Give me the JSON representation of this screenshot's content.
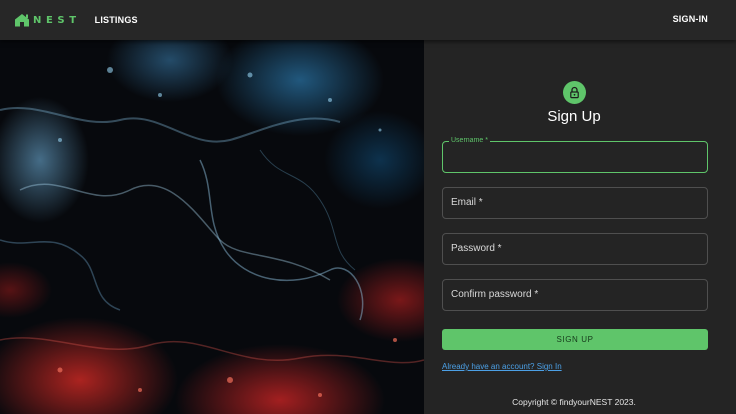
{
  "nav": {
    "brand_text": "NEST",
    "brand_icon": "house-icon",
    "listings_label": "LISTINGS",
    "signin_label": "SIGN-IN"
  },
  "hero": {
    "image": "abstract blue and red fluid art"
  },
  "form": {
    "icon": "lock-icon",
    "title": "Sign Up",
    "fields": {
      "username": {
        "label": "Username *",
        "value": ""
      },
      "email": {
        "label": "Email *"
      },
      "password": {
        "label": "Password *"
      },
      "confirm_password": {
        "label": "Confirm password *"
      }
    },
    "submit_label": "SIGN UP",
    "signin_link": "Already have an account? Sign In"
  },
  "footer": {
    "copyright": "Copyright © findyourNEST 2023."
  },
  "colors": {
    "accent": "#5fc56a",
    "background": "#242424",
    "topbar": "#272727",
    "link": "#4ca0e6"
  }
}
